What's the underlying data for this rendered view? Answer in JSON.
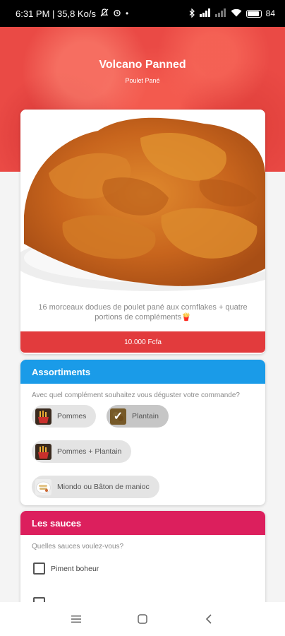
{
  "status_bar": {
    "left_text": "6:31 PM | 35,8 Ko/s",
    "battery": "84"
  },
  "header": {
    "title": "Volcano Panned",
    "subtitle": "Poulet Pané"
  },
  "product": {
    "description": "16 morceaux dodues de poulet pané aux cornflakes + quatre portions de compléments🍟",
    "price": "10.000 Fcfa"
  },
  "assortiments": {
    "title": "Assortiments",
    "question": "Avec quel complément souhaitez vous déguster votre commande?",
    "options": [
      {
        "label": "Pommes",
        "selected": false
      },
      {
        "label": "Plantain",
        "selected": true
      },
      {
        "label": "Pommes + Plantain",
        "selected": false
      },
      {
        "label": "Miondo ou Bâton de manioc",
        "selected": false
      }
    ]
  },
  "sauces": {
    "title": "Les sauces",
    "question": "Quelles sauces voulez-vous?",
    "options": [
      {
        "label": "Piment boheur",
        "checked": false
      },
      {
        "label": "",
        "checked": false
      }
    ]
  },
  "colors": {
    "header_red": "#ea4a45",
    "price_red": "#e23b3d",
    "assort_blue": "#1a9be8",
    "sauce_pink": "#dc1f5d"
  },
  "icons": [
    "mute-icon",
    "alarm-icon",
    "bluetooth-icon",
    "signal-icon",
    "wifi-icon",
    "battery-icon",
    "menu-nav-icon",
    "home-nav-icon",
    "back-nav-icon"
  ]
}
